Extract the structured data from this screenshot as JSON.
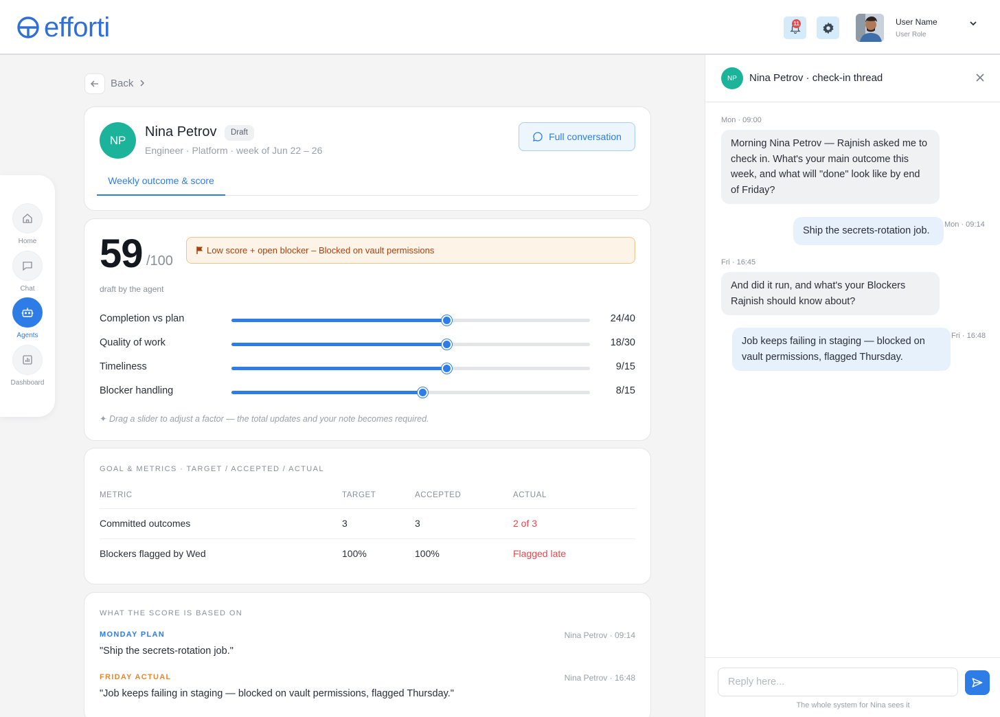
{
  "header": {
    "logo_text": "efforti",
    "notification_count": "11",
    "user_name": "User Name",
    "user_role": "User Role",
    "accent": "#2e7ce6"
  },
  "sidebar": {
    "items": [
      {
        "label": "Home",
        "icon": "home-icon"
      },
      {
        "label": "Chat",
        "icon": "chat-icon"
      },
      {
        "label": "Agents",
        "icon": "robot-icon",
        "active": true
      },
      {
        "label": "Dashboard",
        "icon": "dashboard-icon"
      }
    ]
  },
  "breadcrumb": {
    "back_label": "Back"
  },
  "profile": {
    "initials": "NP",
    "name": "Nina Petrov",
    "status": "Draft",
    "subtitle": "Engineer · Platform · week of Jun 22 – 26",
    "full_conversation_label": "Full conversation",
    "tab_label": "Weekly outcome & score"
  },
  "score": {
    "value": "59",
    "out_of": "/100",
    "note": "draft by the agent",
    "alert": "Low score + open blocker – Blocked on vault permissions",
    "factors": [
      {
        "label": "Completion vs plan",
        "value": "24/40",
        "level": 0.6
      },
      {
        "label": "Quality of work",
        "value": "18/30",
        "level": 0.6
      },
      {
        "label": "Timeliness",
        "value": "9/15",
        "level": 0.6
      },
      {
        "label": "Blocker handling",
        "value": "8/15",
        "level": 0.533
      }
    ],
    "hint": "Drag a slider to adjust a factor — the total updates and your note becomes required."
  },
  "metrics": {
    "section_title": "GOAL & METRICS · TARGET / ACCEPTED / ACTUAL",
    "columns": [
      "METRIC",
      "TARGET",
      "ACCEPTED",
      "ACTUAL"
    ],
    "rows": [
      {
        "metric": "Committed outcomes",
        "target": "3",
        "accepted": "3",
        "actual": "2 of 3"
      },
      {
        "metric": "Blockers flagged by Wed",
        "target": "100%",
        "accepted": "100%",
        "actual": "Flagged late"
      }
    ]
  },
  "basis": {
    "section_title": "WHAT THE SCORE IS BASED ON",
    "items": [
      {
        "tag": "MONDAY PLAN",
        "meta": "Nina Petrov · 09:14",
        "quote": "\"Ship the secrets-rotation job.\"",
        "color": "#2e7ce6"
      },
      {
        "tag": "FRIDAY ACTUAL",
        "meta": "Nina Petrov · 16:48",
        "quote": "\"Job keeps failing in staging — blocked on vault permissions, flagged Thursday.\"",
        "color": "#e8862a"
      }
    ]
  },
  "thread": {
    "initials": "NP",
    "title": "Nina Petrov · check-in thread",
    "messages": [
      {
        "time": "Mon · 09:00",
        "text": "Morning Nina Petrov — Rajnish asked me to check in. What's your main outcome this week, and what will \"done\" look like by end of Friday?",
        "from": "agent"
      },
      {
        "time": "Mon · 09:14",
        "text": "Ship the secrets-rotation job.",
        "from": "user"
      },
      {
        "time": "Fri · 16:45",
        "text": "And did it run, and what's your Blockers Rajnish should know about?",
        "from": "agent"
      },
      {
        "time": "Fri · 16:48",
        "text": "Job keeps failing in staging — blocked on vault permissions, flagged Thursday.",
        "from": "user"
      }
    ],
    "reply_placeholder": "Reply here...",
    "composer_note": "The whole system for Nina sees it"
  }
}
